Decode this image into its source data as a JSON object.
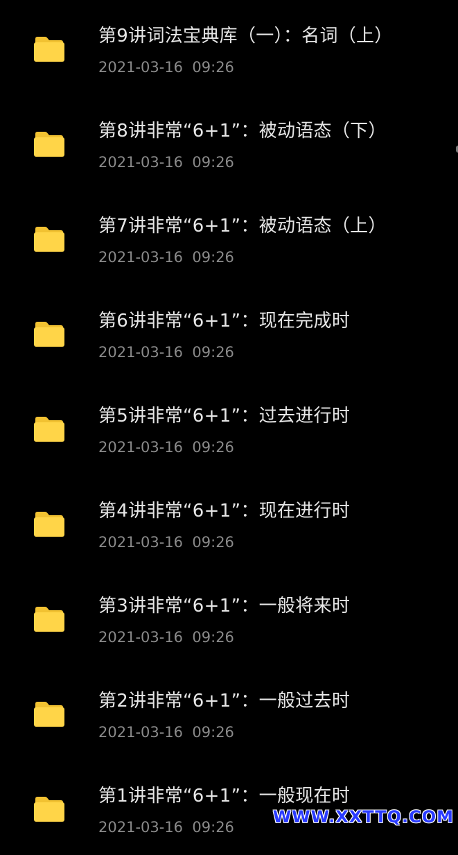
{
  "colors": {
    "background": "#000000",
    "folder": "#FFD548",
    "folder_tab": "#F2C232",
    "title_text": "#E6E6E6",
    "date_text": "#8A8A8A",
    "watermark": "#2A3BFF"
  },
  "items": [
    {
      "title": "第9讲词法宝典库（一）：名词（上）",
      "date": "2021-03-16  09:26",
      "icon": "folder-icon"
    },
    {
      "title": "第8讲非常“6+1”：被动语态（下）",
      "date": "2021-03-16  09:26",
      "icon": "folder-icon"
    },
    {
      "title": "第7讲非常“6+1”：被动语态（上）",
      "date": "2021-03-16  09:26",
      "icon": "folder-icon"
    },
    {
      "title": "第6讲非常“6+1”：现在完成时",
      "date": "2021-03-16  09:26",
      "icon": "folder-icon"
    },
    {
      "title": "第5讲非常“6+1”：过去进行时",
      "date": "2021-03-16  09:26",
      "icon": "folder-icon"
    },
    {
      "title": "第4讲非常“6+1”：现在进行时",
      "date": "2021-03-16  09:26",
      "icon": "folder-icon"
    },
    {
      "title": "第3讲非常“6+1”：一般将来时",
      "date": "2021-03-16  09:26",
      "icon": "folder-icon"
    },
    {
      "title": "第2讲非常“6+1”：一般过去时",
      "date": "2021-03-16  09:26",
      "icon": "folder-icon"
    },
    {
      "title": "第1讲非常“6+1”：一般现在时",
      "date": "2021-03-16  09:26",
      "icon": "folder-icon"
    }
  ],
  "watermark": "WWW.XXTTQ.COM"
}
